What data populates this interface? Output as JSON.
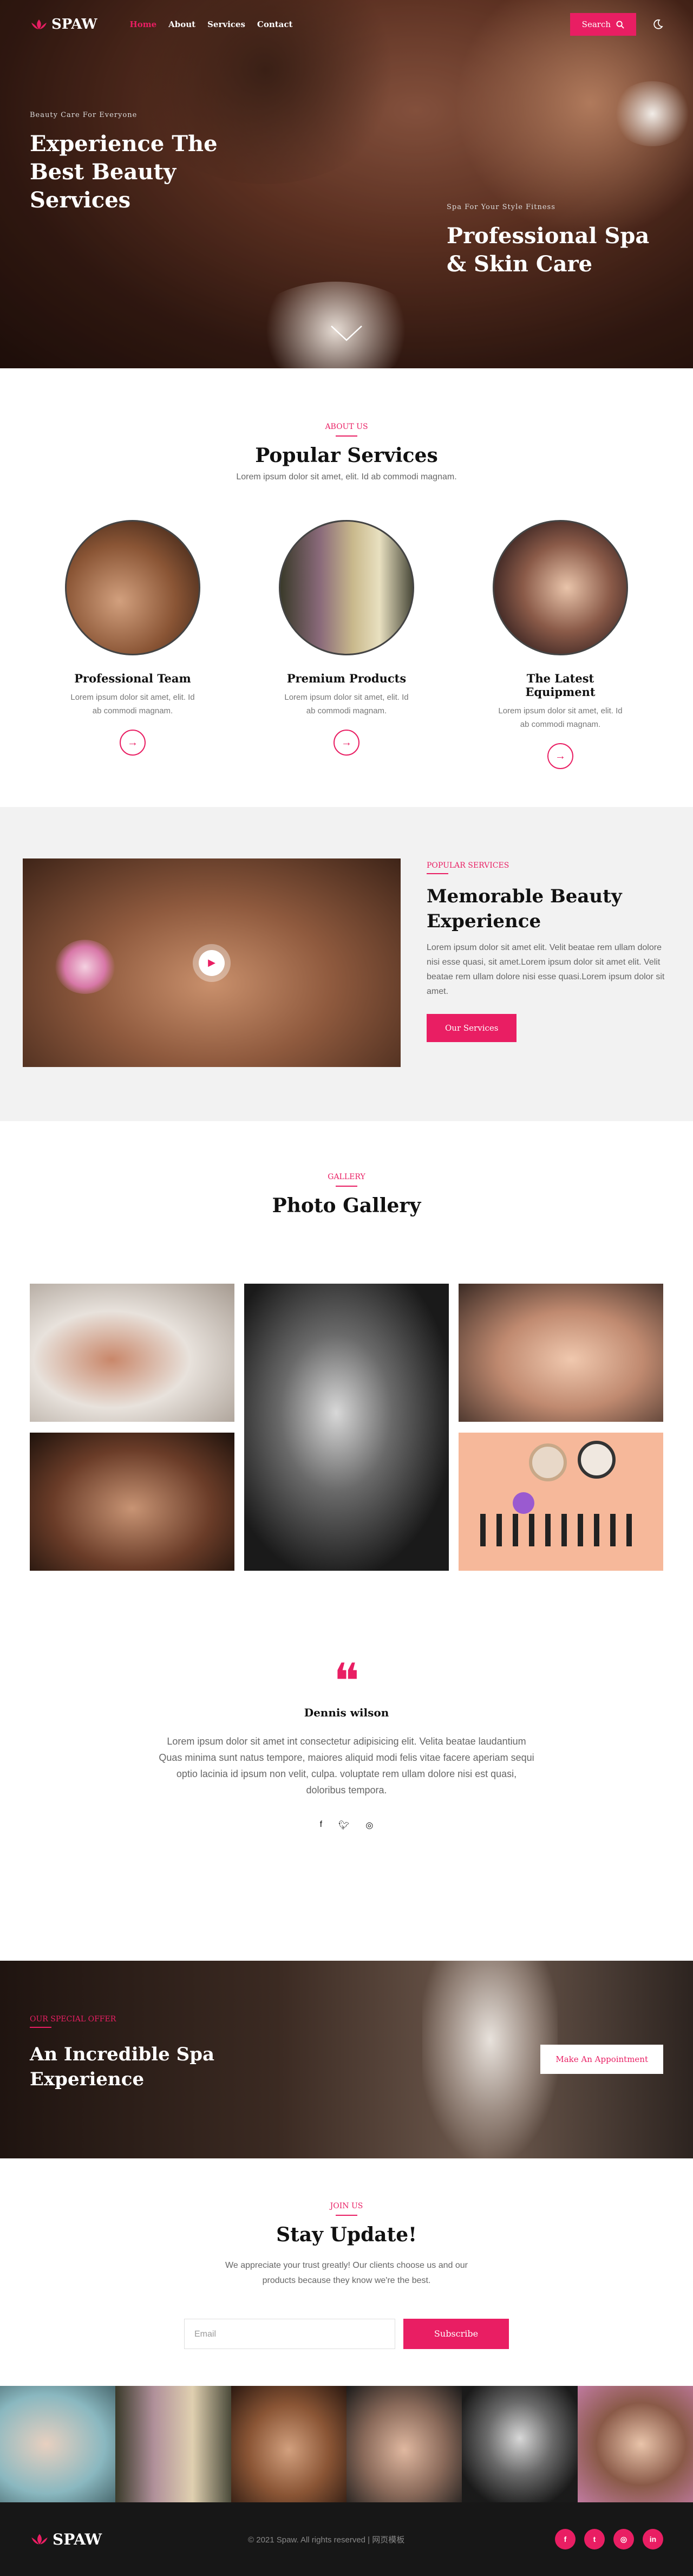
{
  "brand": {
    "name": "SPAW",
    "accent": "#e91e63"
  },
  "nav": {
    "links": [
      "Home",
      "About",
      "Services",
      "Contact"
    ],
    "search_label": "Search"
  },
  "hero": {
    "left_kicker": "Beauty Care For Everyone",
    "left_title": "Experience The Best Beauty Services",
    "right_kicker": "Spa For Your Style Fitness",
    "right_title": "Professional Spa & Skin Care"
  },
  "services": {
    "kicker": "ABOUT US",
    "title": "Popular Services",
    "subtitle": "Lorem ipsum dolor sit amet, elit. Id ab commodi magnam.",
    "items": [
      {
        "title": "Professional Team",
        "desc": "Lorem ipsum dolor sit amet, elit. Id ab commodi magnam."
      },
      {
        "title": "Premium Products",
        "desc": "Lorem ipsum dolor sit amet, elit. Id ab commodi magnam."
      },
      {
        "title": "The Latest Equipment",
        "desc": "Lorem ipsum dolor sit amet, elit. Id ab commodi magnam."
      }
    ]
  },
  "popular": {
    "kicker": "POPULAR SERVICES",
    "title": "Memorable Beauty Experience",
    "text": "Lorem ipsum dolor sit amet elit. Velit beatae rem ullam dolore nisi esse quasi, sit amet.Lorem ipsum dolor sit amet elit. Velit beatae rem ullam dolore nisi esse quasi.Lorem ipsum dolor sit amet.",
    "button": "Our Services"
  },
  "gallery": {
    "kicker": "GALLERY",
    "title": "Photo Gallery"
  },
  "testimonial": {
    "name": "Dennis wilson",
    "text": "Lorem ipsum dolor sit amet int consectetur adipisicing elit. Velita beatae laudantium Quas minima sunt natus tempore, maiores aliquid modi felis vitae facere aperiam sequi optio lacinia id ipsum non velit, culpa. voluptate rem ullam dolore nisi est quasi, doloribus tempora."
  },
  "offer": {
    "kicker": "OUR SPECIAL OFFER",
    "title": "An Incredible Spa Experience",
    "button": "Make An Appointment"
  },
  "subscribe": {
    "kicker": "JOIN US",
    "title": "Stay Update!",
    "text": "We appreciate your trust greatly! Our clients choose us and our products because they know we're the best.",
    "placeholder": "Email",
    "button": "Subscribe"
  },
  "footer": {
    "copyright": "© 2021 Spaw. All rights reserved | 网页模板"
  }
}
